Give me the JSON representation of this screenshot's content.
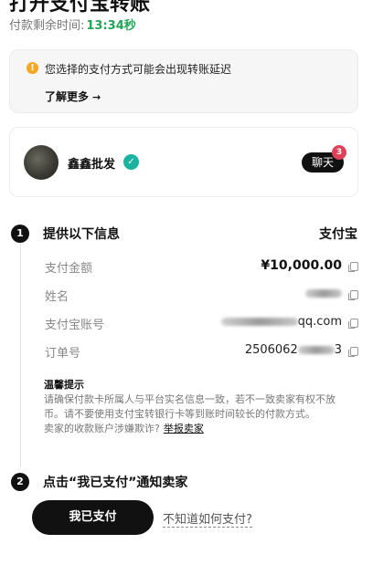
{
  "header": {
    "title": "打开支付宝转账",
    "timer_label": "付款剩余时间:",
    "timer_value": "13:34秒"
  },
  "notice": {
    "icon": "warning-icon",
    "icon_glyph": "!",
    "message": "您选择的支付方式可能会出现转账延迟",
    "learn_more": "了解更多",
    "learn_more_arrow": "→"
  },
  "seller": {
    "name": "鑫鑫批发",
    "verified_glyph": "✓",
    "chat_label": "聊天",
    "unread_count": "3"
  },
  "step1": {
    "number": "1",
    "title": "提供以下信息",
    "method": "支付宝",
    "rows": [
      {
        "label": "支付金额",
        "value": "¥10,000.00"
      },
      {
        "label": "姓名",
        "value": ""
      },
      {
        "label": "支付宝账号",
        "value_suffix": "qq.com"
      },
      {
        "label": "订单号",
        "value_prefix": "2506062",
        "value_suffix": "3"
      }
    ]
  },
  "tips": {
    "title": "温馨提示",
    "line1": "请确保付款卡所属人与平台实名信息一致，若不一致卖家有权不放币。请不要使用支付宝转银行卡等到账时间较长的付款方式。",
    "line2": "卖家的收款账户涉嫌欺诈?",
    "report": "举报卖家"
  },
  "step2": {
    "number": "2",
    "title": "点击“我已支付”通知卖家",
    "paid_button": "我已支付",
    "how_link": "不知道如何支付?"
  },
  "colors": {
    "timer_green": "#22a559",
    "warning_orange": "#f5a623",
    "verified_teal": "#19b3a0",
    "badge_red": "#e0415a"
  }
}
